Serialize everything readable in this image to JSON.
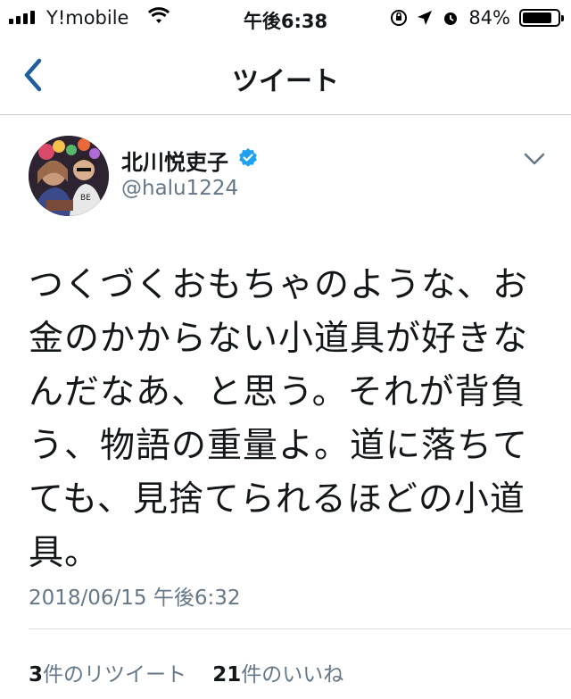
{
  "status_bar": {
    "carrier": "Y!mobile",
    "time": "午後6:38",
    "battery": "84%",
    "battery_level": 0.84
  },
  "nav": {
    "title": "ツイート"
  },
  "tweet": {
    "author_name": "北川悦吏子",
    "author_handle": "@halu1224",
    "text": "つくづくおもちゃのような、お金のかからない小道具が好きなんだなあ、と思う。それが背負う、物語の重量よ。道に落ちてても、見捨てられるほどの小道具。",
    "timestamp": "2018/06/15 午後6:32",
    "retweet_count": "3",
    "retweet_label": "件のリツイート",
    "like_count": "21",
    "like_label": "件のいいね"
  },
  "colors": {
    "accent": "#1f5f9e",
    "verified": "#1da1f2",
    "muted": "#657786"
  }
}
